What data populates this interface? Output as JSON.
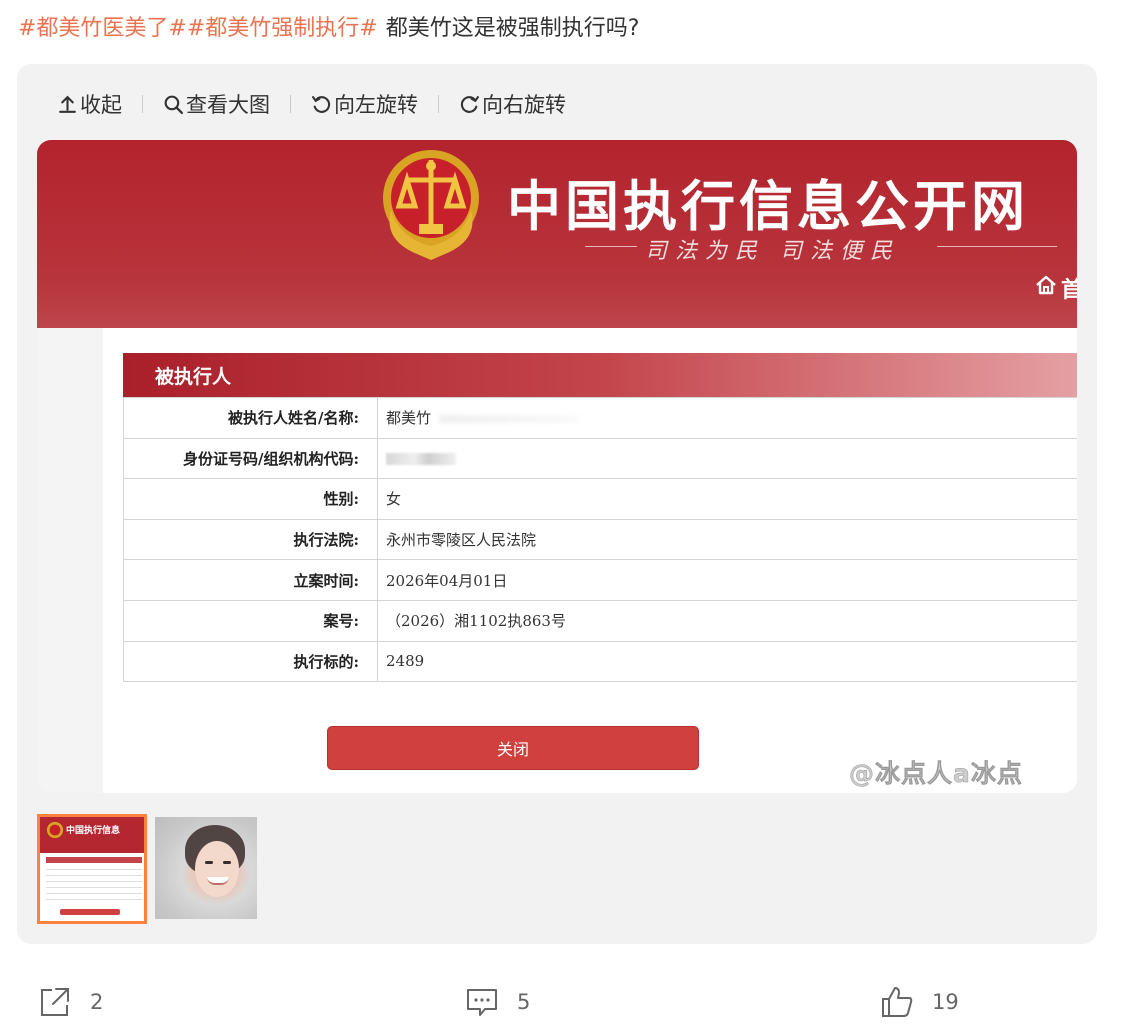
{
  "post": {
    "tags": [
      "#都美竹医美了#",
      "#都美竹强制执行#"
    ],
    "text": "都美竹这是被强制执行吗?"
  },
  "toolbar": {
    "collapse_label": "收起",
    "view_large_label": "查看大图",
    "rotate_left_label": "向左旋转",
    "rotate_right_label": "向右旋转"
  },
  "image": {
    "site_title": "中国执行信息公开网",
    "slogan": "司法为民 司法便民",
    "home_partial": "首",
    "section_title": "被执行人",
    "rows": [
      {
        "label": "被执行人姓名/名称:",
        "value": "都美竹"
      },
      {
        "label": "身份证号码/组织机构代码:",
        "value": ""
      },
      {
        "label": "性别:",
        "value": "女"
      },
      {
        "label": "执行法院:",
        "value": "永州市零陵区人民法院"
      },
      {
        "label": "立案时间:",
        "value": "2026年04月01日"
      },
      {
        "label": "案号:",
        "value": "（2026）湘1102执863号"
      },
      {
        "label": "执行标的:",
        "value": "2489"
      }
    ],
    "close_label": "关闭",
    "watermark": "@冰点人a冰点",
    "thumb_title": "中国执行信息"
  },
  "actions": {
    "share_count": "2",
    "comment_count": "5",
    "like_count": "19"
  },
  "colors": {
    "tag": "#eb7350",
    "header_red": "#b3232d",
    "button_red": "#d0403f",
    "active_thumb": "#ff8140"
  }
}
